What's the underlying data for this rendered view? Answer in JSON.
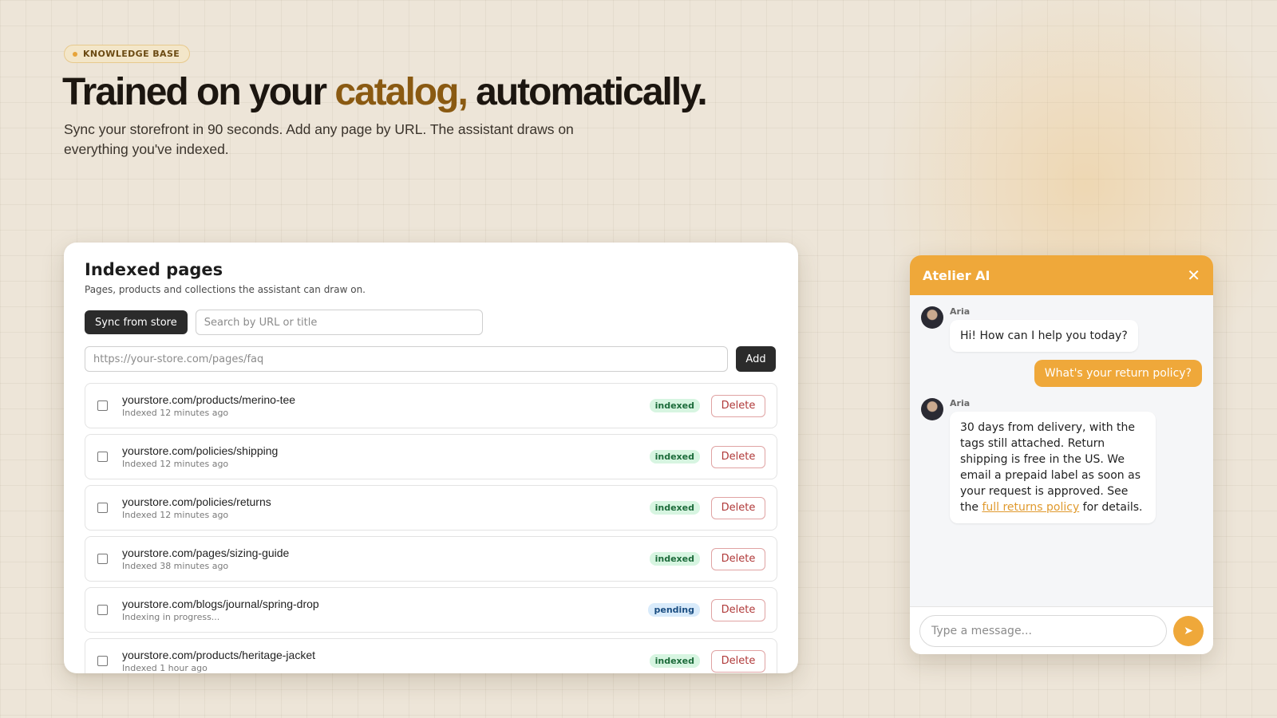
{
  "hero": {
    "badge": "KNOWLEDGE BASE",
    "title_start": "Trained on your",
    "title_accent": "catalog,",
    "title_end": "automatically.",
    "subtitle": "Sync your storefront in 90 seconds. Add any page by URL. The assistant draws on everything you've indexed."
  },
  "panel": {
    "title": "Indexed pages",
    "subtitle": "Pages, products and collections the assistant can draw on.",
    "sync_label": "Sync from store",
    "search_placeholder": "Search by URL or title",
    "url_placeholder": "https://your-store.com/pages/faq",
    "add_label": "Add",
    "delete_label": "Delete",
    "rows": [
      {
        "url": "yourstore.com/products/merino-tee",
        "meta": "Indexed 12 minutes ago",
        "status": "indexed"
      },
      {
        "url": "yourstore.com/policies/shipping",
        "meta": "Indexed 12 minutes ago",
        "status": "indexed"
      },
      {
        "url": "yourstore.com/policies/returns",
        "meta": "Indexed 12 minutes ago",
        "status": "indexed"
      },
      {
        "url": "yourstore.com/pages/sizing-guide",
        "meta": "Indexed 38 minutes ago",
        "status": "indexed"
      },
      {
        "url": "yourstore.com/blogs/journal/spring-drop",
        "meta": "Indexing in progress...",
        "status": "pending"
      },
      {
        "url": "yourstore.com/products/heritage-jacket",
        "meta": "Indexed 1 hour ago",
        "status": "indexed"
      }
    ]
  },
  "chat": {
    "title": "Atelier AI",
    "bot_name": "Aria",
    "greeting": "Hi! How can I help you today?",
    "user_message": "What's your return policy?",
    "reply_before_link": "30 days from delivery, with the tags still attached. Return shipping is free in the US. We email a prepaid label as soon as your request is approved. See the ",
    "reply_link": "full returns policy",
    "reply_after_link": " for details.",
    "input_placeholder": "Type a message..."
  },
  "colors": {
    "accent": "#efa83a",
    "title_accent": "#8a5a12",
    "indexed_badge": "#d7f5e1",
    "pending_badge": "#d9ebfb"
  }
}
